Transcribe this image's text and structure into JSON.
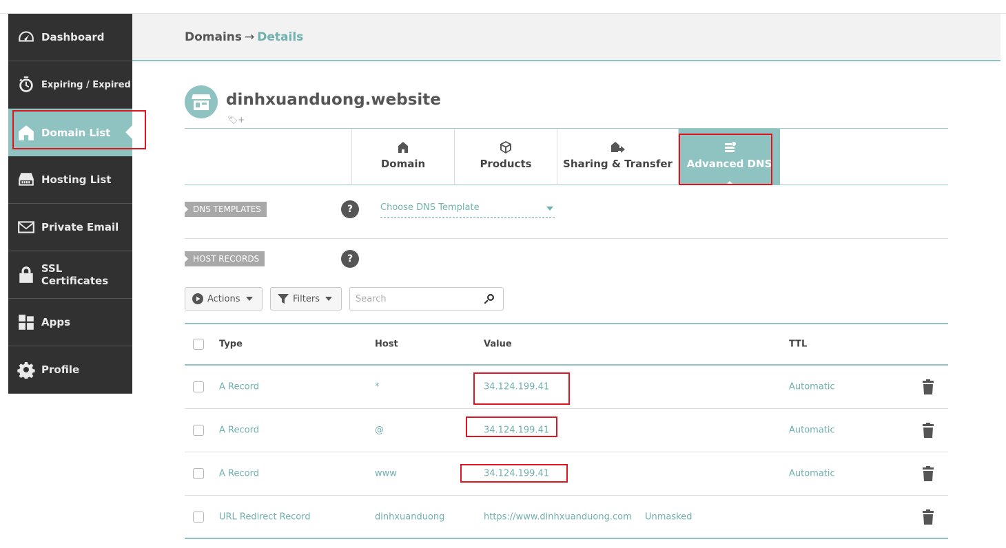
{
  "sidebar": {
    "items": [
      {
        "label": "Dashboard",
        "icon": "gauge-icon"
      },
      {
        "label": "Expiring / Expired",
        "icon": "timer-icon"
      },
      {
        "label": "Domain List",
        "icon": "home-icon"
      },
      {
        "label": "Hosting List",
        "icon": "server-icon"
      },
      {
        "label": "Private Email",
        "icon": "envelope-icon"
      },
      {
        "label": "SSL Certificates",
        "icon": "lock-icon"
      },
      {
        "label": "Apps",
        "icon": "apps-icon"
      },
      {
        "label": "Profile",
        "icon": "gear-icon"
      }
    ],
    "active": "Domain List"
  },
  "breadcrumb": {
    "parent": "Domains",
    "separator": "→",
    "current": "Details"
  },
  "domain": {
    "name": "dinhxuanduong.website"
  },
  "tabs": [
    {
      "label": "Domain",
      "icon": "home-icon"
    },
    {
      "label": "Products",
      "icon": "box-icon"
    },
    {
      "label": "Sharing & Transfer",
      "icon": "transfer-icon"
    },
    {
      "label": "Advanced DNS",
      "icon": "dns-icon"
    }
  ],
  "active_tab": "Advanced DNS",
  "dns_templates": {
    "label": "DNS TEMPLATES",
    "help": "?",
    "select_value": "Choose DNS Template"
  },
  "host_records": {
    "label": "HOST RECORDS",
    "help": "?"
  },
  "toolbar": {
    "actions_label": "Actions",
    "filters_label": "Filters",
    "search_placeholder": "Search"
  },
  "table": {
    "headers": {
      "type": "Type",
      "host": "Host",
      "value": "Value",
      "ttl": "TTL"
    },
    "rows": [
      {
        "type": "A Record",
        "host": "*",
        "value": "34.124.199.41",
        "extra": "",
        "ttl": "Automatic"
      },
      {
        "type": "A Record",
        "host": "@",
        "value": "34.124.199.41",
        "extra": "",
        "ttl": "Automatic"
      },
      {
        "type": "A Record",
        "host": "www",
        "value": "34.124.199.41",
        "extra": "",
        "ttl": "Automatic"
      },
      {
        "type": "URL Redirect Record",
        "host": "dinhxuanduong",
        "value": "https://www.dinhxuanduong.com",
        "extra": "Unmasked",
        "ttl": ""
      }
    ]
  },
  "colors": {
    "accent": "#8fc3c1",
    "link": "#6fb1ae",
    "sidebar": "#313131",
    "highlight": "#e0141e"
  }
}
